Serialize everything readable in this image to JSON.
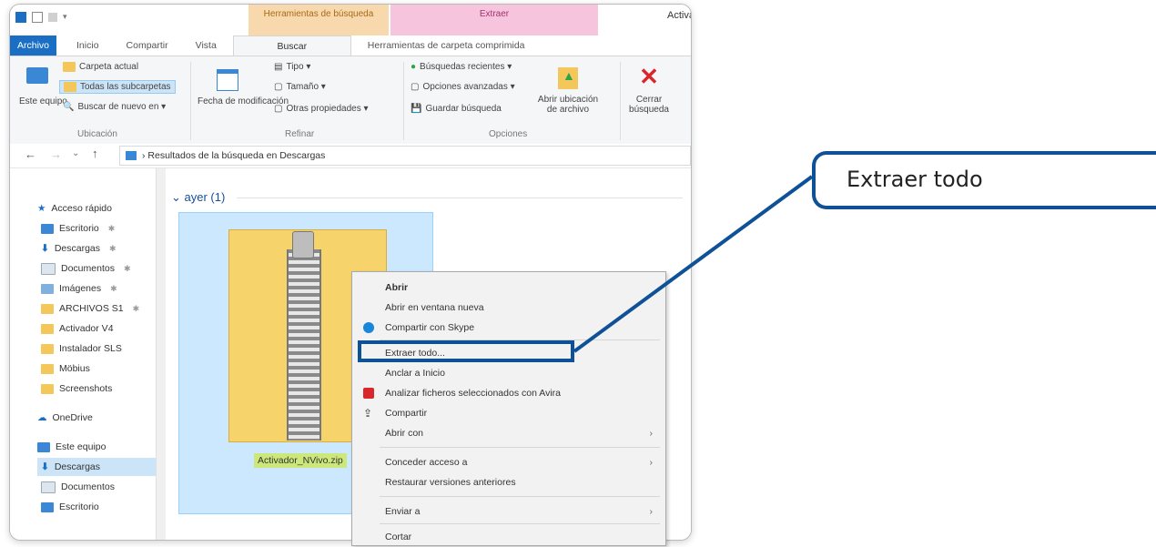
{
  "window": {
    "title": "Activador_NVivo",
    "contextual_tab_search": "Herramientas de búsqueda",
    "contextual_tab_extract": "Extraer"
  },
  "tabs": [
    "Archivo",
    "Inicio",
    "Compartir",
    "Vista",
    "Buscar",
    "Herramientas de carpeta comprimida"
  ],
  "ribbon": {
    "ubicacion": {
      "este_equipo": "Este equipo",
      "carpeta_actual": "Carpeta actual",
      "todas_subcarpetas": "Todas las subcarpetas",
      "buscar_de_nuevo": "Buscar de nuevo en",
      "group": "Ubicación"
    },
    "refinar": {
      "fecha": "Fecha de modificación",
      "tipo": "Tipo",
      "tamano": "Tamaño",
      "otras": "Otras propiedades",
      "group": "Refinar"
    },
    "opciones": {
      "recientes": "Búsquedas recientes",
      "avanzadas": "Opciones avanzadas",
      "guardar": "Guardar búsqueda",
      "abrir_ubicacion": "Abrir ubicación de archivo",
      "group": "Opciones"
    },
    "cerrar": "Cerrar búsqueda"
  },
  "address": {
    "path": "Resultados de la búsqueda en Descargas"
  },
  "nav": {
    "quick_access": "Acceso rápido",
    "items": [
      "Escritorio",
      "Descargas",
      "Documentos",
      "Imágenes",
      "ARCHIVOS S1",
      "Activador V4",
      "Instalador SLS",
      "Möbius",
      "Screenshots"
    ],
    "onedrive": "OneDrive",
    "this_pc": "Este equipo",
    "pc_items": [
      "Descargas",
      "Documentos",
      "Escritorio"
    ]
  },
  "content": {
    "group_header": "ayer (1)",
    "file_name": "Activador_NVivo.zip"
  },
  "context_menu": {
    "items": [
      "Abrir",
      "Abrir en ventana nueva",
      "Compartir con Skype",
      "Extraer todo...",
      "Anclar a Inicio",
      "Analizar ficheros seleccionados con Avira",
      "Compartir",
      "Abrir con",
      "Conceder acceso a",
      "Restaurar versiones anteriores",
      "Enviar a",
      "Cortar"
    ]
  },
  "callout": {
    "text": "Extraer todo"
  },
  "colors": {
    "accent": "#0f5196",
    "file_tab": "#1a6fc4",
    "search_tools": "#f8d9ad",
    "extract_tools": "#f7c4dd"
  }
}
